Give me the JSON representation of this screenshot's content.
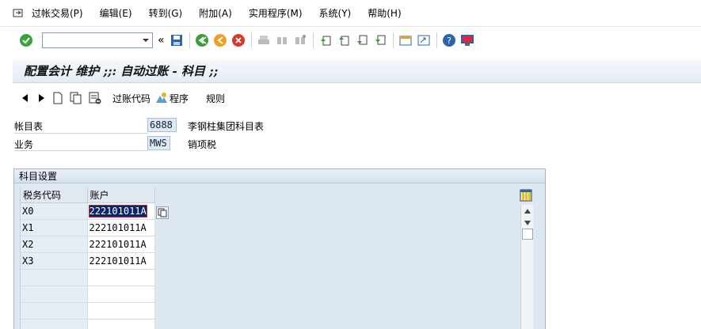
{
  "menu": {
    "items": [
      "过帐交易(P)",
      "编辑(E)",
      "转到(G)",
      "附加(A)",
      "实用程序(M)",
      "系统(Y)",
      "帮助(H)"
    ]
  },
  "toolbar": {
    "command_value": "",
    "history_label": "«"
  },
  "title": "配置会计 维护 ;;: 自动过账 - 科目 ;;",
  "app_toolbar": {
    "posting_key_label": "过账代码",
    "procedure_label": "程序",
    "rules_label": "规则"
  },
  "fields": {
    "chart_label": "帐目表",
    "chart_value": "6888",
    "chart_desc": "李钢柱集团科目表",
    "transaction_label": "业务",
    "transaction_value": "MWS",
    "transaction_desc": "销项税"
  },
  "group": {
    "title": "科目设置"
  },
  "table": {
    "headers": [
      "税务代码",
      "账户"
    ],
    "rows": [
      [
        "X0",
        "222101011A"
      ],
      [
        "X1",
        "222101011A"
      ],
      [
        "X2",
        "222101011A"
      ],
      [
        "X3",
        "222101011A"
      ]
    ]
  },
  "colors": {
    "title_text": "#111111",
    "selection": "#0a246a",
    "field_bg": "#dde9f4"
  }
}
